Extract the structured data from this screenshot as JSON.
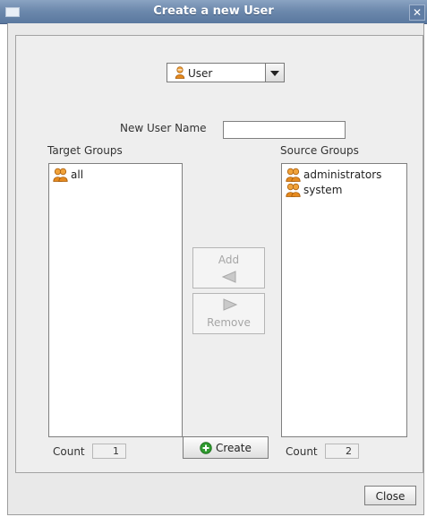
{
  "window": {
    "title": "Create a new User",
    "close_glyph": "✕"
  },
  "type_select": {
    "value": "User",
    "icon": "user-icon"
  },
  "new_user_name": {
    "label": "New User Name",
    "value": "",
    "placeholder": ""
  },
  "target_groups": {
    "label": "Target Groups",
    "items": [
      {
        "label": "all",
        "icon": "group-icon"
      }
    ],
    "count_label": "Count",
    "count": "1"
  },
  "source_groups": {
    "label": "Source Groups",
    "items": [
      {
        "label": "administrators",
        "icon": "group-icon"
      },
      {
        "label": "system",
        "icon": "group-icon"
      }
    ],
    "count_label": "Count",
    "count": "2"
  },
  "transfer": {
    "add_label": "Add",
    "remove_label": "Remove"
  },
  "actions": {
    "create_label": "Create",
    "close_label": "Close"
  },
  "colors": {
    "titlebar": "#6d89ad",
    "create_icon_green": "#2f9a2f",
    "user_icon_orange": "#e58a1f"
  }
}
